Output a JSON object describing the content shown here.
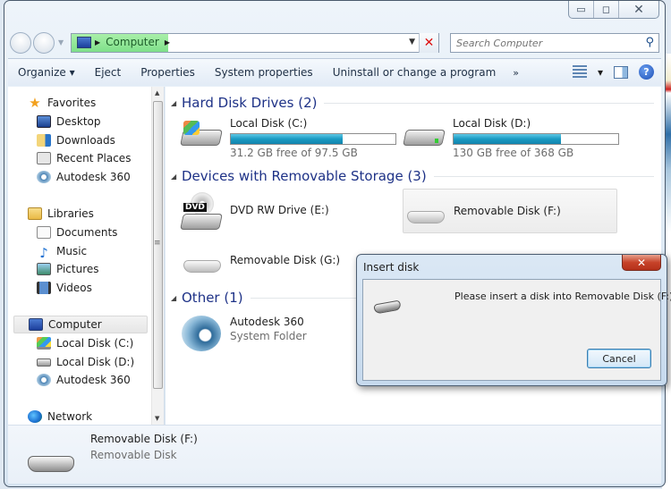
{
  "window": {
    "caption_buttons": {
      "minimize": "▭",
      "maximize": "◻",
      "close": "✕"
    }
  },
  "address_bar": {
    "crumbs": [
      "Computer"
    ],
    "icon": "computer-icon"
  },
  "search": {
    "placeholder": "Search Computer",
    "value": ""
  },
  "toolbar": {
    "organize": "Organize ▾",
    "eject": "Eject",
    "properties": "Properties",
    "system_properties": "System properties",
    "uninstall": "Uninstall or change a program",
    "more": "»",
    "views_dropdown": "▾",
    "help": "?"
  },
  "sidebar": {
    "favorites": {
      "label": "Favorites",
      "items": [
        "Desktop",
        "Downloads",
        "Recent Places",
        "Autodesk 360"
      ]
    },
    "libraries": {
      "label": "Libraries",
      "items": [
        "Documents",
        "Music",
        "Pictures",
        "Videos"
      ]
    },
    "computer": {
      "label": "Computer",
      "items": [
        "Local Disk (C:)",
        "Local Disk (D:)",
        "Autodesk 360"
      ]
    },
    "network": {
      "label": "Network"
    }
  },
  "content": {
    "groups": [
      {
        "title": "Hard Disk Drives (2)",
        "items": [
          {
            "name": "Local Disk (C:)",
            "free_text": "31.2 GB free of 97.5 GB",
            "used_fraction": 0.68
          },
          {
            "name": "Local Disk (D:)",
            "free_text": "130 GB free of 368 GB",
            "used_fraction": 0.65
          }
        ]
      },
      {
        "title": "Devices with Removable Storage (3)",
        "items": [
          {
            "name": "DVD RW Drive (E:)"
          },
          {
            "name": "Removable Disk (F:)"
          },
          {
            "name": "Removable Disk (G:)"
          }
        ]
      },
      {
        "title": "Other (1)",
        "items": [
          {
            "name": "Autodesk 360",
            "subtitle": "System Folder"
          }
        ]
      }
    ]
  },
  "details": {
    "name": "Removable Disk (F:)",
    "type": "Removable Disk"
  },
  "dialog": {
    "title": "Insert disk",
    "message": "Please insert a disk into Removable Disk (F:).",
    "cancel": "Cancel",
    "close": "✕"
  }
}
